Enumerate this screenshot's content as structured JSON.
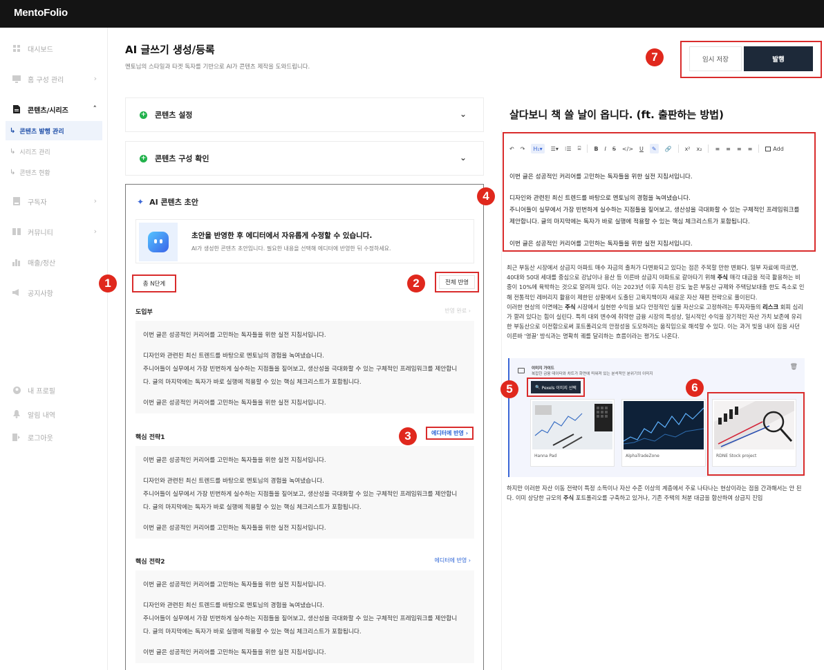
{
  "app": {
    "brand": "MentoFolio"
  },
  "sidebar": {
    "items": [
      {
        "label": "대시보드",
        "icon": "grid-icon"
      },
      {
        "label": "홈 구성 관리",
        "icon": "monitor-icon"
      },
      {
        "label": "콘텐츠/시리즈",
        "icon": "document-icon"
      },
      {
        "label": "구독자",
        "icon": "subscriber-icon"
      },
      {
        "label": "커뮤니티",
        "icon": "book-icon"
      },
      {
        "label": "매출/정산",
        "icon": "bar-chart-icon"
      },
      {
        "label": "공지사항",
        "icon": "megaphone-icon"
      }
    ],
    "sub_items": [
      {
        "label": "콘텐츠 발행 관리"
      },
      {
        "label": "시리즈 관리"
      },
      {
        "label": "콘텐츠 현황"
      }
    ],
    "bottom": [
      {
        "label": "내 프로필",
        "icon": "user-icon"
      },
      {
        "label": "알림 내역",
        "icon": "bell-icon"
      },
      {
        "label": "로그아웃",
        "icon": "logout-icon"
      }
    ]
  },
  "header": {
    "title": "AI 글쓰기 생성/등록",
    "subtitle": "멘토님의 스타일과 타겟 독자를 기반으로 AI가 콘텐츠 제작을 도와드립니다.",
    "temp_save": "임시 저장",
    "publish": "발행"
  },
  "badges": [
    "1",
    "2",
    "3",
    "4",
    "5",
    "6",
    "7"
  ],
  "accordions": [
    {
      "label": "콘텐츠 설정"
    },
    {
      "label": "콘텐츠 구성 확인"
    }
  ],
  "ai_panel": {
    "title": "AI 콘텐츠 초안",
    "banner_title": "초안을 반영한 후 에디터에서 자유롭게 수정할 수 있습니다.",
    "banner_desc": "AI가 생성한 콘텐츠 초안입니다. 필요한 내용을 선택해 에디터에 반영한 뒤 수정하세요.",
    "steps_label": "총 N단계",
    "apply_all": "전체 반영",
    "sections": [
      {
        "title": "도입부",
        "action": "반영 완료"
      },
      {
        "title": "핵심 전략1",
        "action": "에디터에 반영"
      },
      {
        "title": "핵심 전략2",
        "action": "에디터에 반영"
      }
    ],
    "body": {
      "line1": "이번 글은 성공적인 커리어를 고민하는 독자들을 위한 실전 지침서입니다.",
      "line2": "디자인와 관련된 최신 트렌드를 바탕으로 멘토님의 경험을 녹여냈습니다.",
      "line3": "주니어들이 실무에서 가장 빈번하게 실수하는 지점들을 짚어보고, 생산성을 극대화할 수 있는 구체적인 프레임워크를 제안합니",
      "line4": "다. 글의 마지막에는 독자가 바로 실행에 적용할 수 있는 핵심 체크리스트가 포함됩니다.",
      "line5": "이번 글은 성공적인 커리어를 고민하는 독자들을 위한 실전 지침서입니다."
    }
  },
  "editor": {
    "title": "살다보니 책 쓸 날이 옵니다. (ft. 출판하는 방법)",
    "toolbar": {
      "undo": "↶",
      "redo": "↷",
      "heading": "H₁▾",
      "list": "☰▾",
      "ordered": "⁝☰",
      "code_block": "⌸",
      "bold": "B",
      "italic": "I",
      "strike": "S",
      "code": "</>",
      "underline": "U",
      "highlight": "✎",
      "link": "🔗",
      "sup": "x²",
      "sub": "x₂",
      "align_left": "≡",
      "align_center": "≡",
      "align_right": "≡",
      "align_justify": "≡",
      "add": "Add"
    },
    "lines": [
      "이번 글은 성공적인 커리어를 고민하는 독자들을 위한 실전 지침서입니다.",
      "디자인와 관련된 최신 트렌드를 바탕으로 멘토님의 경험을 녹여냈습니다.",
      "주니어들이 실무에서 가장 빈번하게 실수하는 지점들을 짚어보고, 생산성을 극대화할 수 있는 구체적인 프레임워크를",
      "제안합니다. 글의 마지막에는 독자가 바로 실행에 적용할 수 있는 핵심 체크리스트가 포함됩니다.",
      "이번 글은 성공적인 커리어를 고민하는 독자들을 위한 실전 지침서입니다."
    ],
    "article_p1_a": "최근 부동산 시장에서 상급지 아파트 매수 자금의 출처가 다변화되고 있다는 점은 주목할 만한 변화다. 일부 자료에 따르면, 40대와 50대 세대를 중심으로 강남이나 용산 등 이른바 상급지 아파트로 갈아타기 위해 ",
    "article_p1_b": "주식",
    "article_p1_c": " 매각 대금을 적극 활용하는 비중이 10%에 육박하는 것으로 알려져 있다. 이는 2023년 이후 지속된 강도 높은 부동산 규제와 주택담보대출 한도 축소로 인해 전통적인 레버리지 활용이 제한된 상황에서 도출된 고육지책이자 새로운 자산 재편 전략으로 풀이된다.",
    "article_p2_a": "이러한 현상의 이면에는 ",
    "article_p2_b": "주식",
    "article_p2_c": " 시장에서 실현한 수익을 보다 안정적인 실물 자산으로 고정하려는 투자자들의 ",
    "article_p2_d": "리스크",
    "article_p2_e": " 회피 심리가 깔려 있다는 힘이 실린다. 특히 대외 변수에 취약한 금융 시장의 특성상, 일시적인 수익을 장기적인 자산 가치 보존에 유리한 부동산으로 이전함으로써 포트폴리오의 안정성을 도모하려는 움직임으로 해석할 수 있다. 이는 과거 빚을 내어 집을 사던 이른바 '영끌' 방식과는 명확히 궤를 달리하는 흐름이라는 평가도 나온다.",
    "image_block": {
      "guide_title": "이미지 가이드",
      "guide_desc": "복잡한 금융 데이터와 차트가 화면에 띄워져 있는 분석적인 분위기의 이미지",
      "pexels_btn": "Pexels 이미지 선택",
      "images": [
        {
          "caption": "Hanna Pad"
        },
        {
          "caption": "AlphaTradeZone"
        },
        {
          "caption": "RDNE Stock project"
        }
      ]
    },
    "article_p3_a": "하지만 이러한 자산 이동 전략이 특정 소득이나 자산 수준 이상의 계층에서 주로 나타나는 현상이라는 점을 간과해서는 안 된다. 이미 상당한 규모의 ",
    "article_p3_b": "주식",
    "article_p3_c": " 포트폴리오를 구축하고 있거나, 기존 주택의 처분 대금을 합산하여 상급지 진입"
  }
}
